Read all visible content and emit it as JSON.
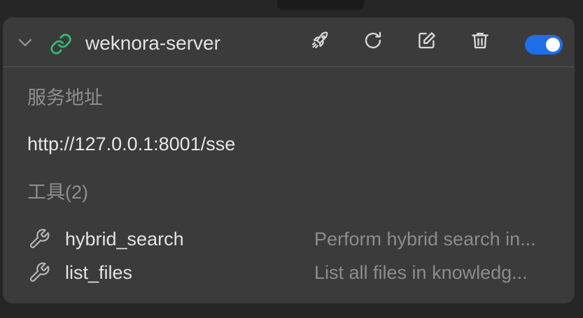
{
  "server": {
    "name": "weknora-server",
    "enabled": true,
    "expanded": true,
    "icon": "link-icon"
  },
  "actions": [
    {
      "name": "deploy",
      "icon": "rocket-icon"
    },
    {
      "name": "refresh",
      "icon": "refresh-icon"
    },
    {
      "name": "edit",
      "icon": "edit-icon"
    },
    {
      "name": "delete",
      "icon": "trash-icon"
    }
  ],
  "details": {
    "address_label": "服务地址",
    "address_value": "http://127.0.0.1:8001/sse",
    "tools_label": "工具(2)"
  },
  "tools": [
    {
      "name": "hybrid_search",
      "description": "Perform hybrid search in...",
      "icon": "wrench-icon"
    },
    {
      "name": "list_files",
      "description": "List all files in knowledg...",
      "icon": "wrench-icon"
    }
  ],
  "colors": {
    "background": "#262626",
    "card": "#3b3b3b",
    "accent": "#1e6fe8",
    "link_icon": "#2fbf71"
  }
}
